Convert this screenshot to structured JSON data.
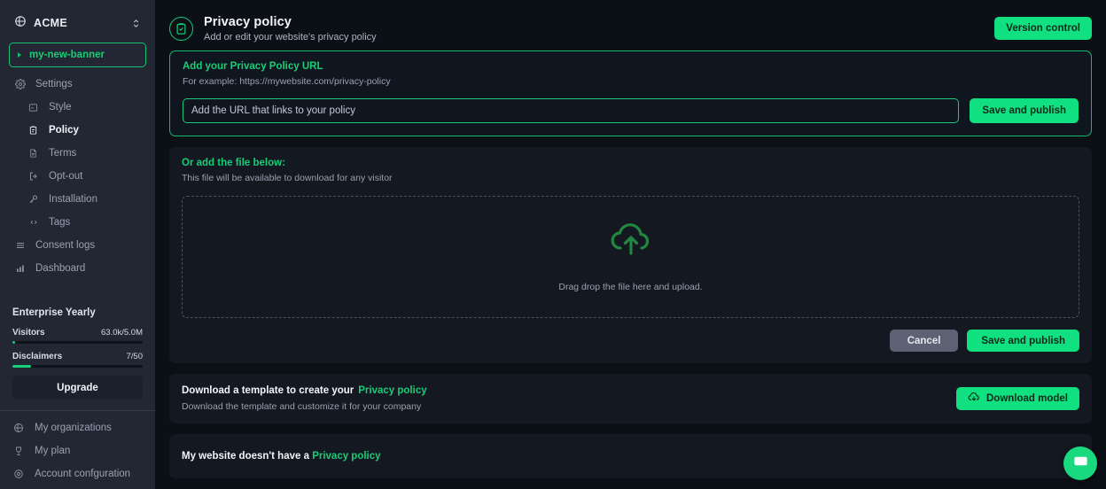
{
  "sidebar": {
    "org": {
      "name": "ACME",
      "icon": "globe-icon",
      "switcher_icon": "chevron-updown-icon"
    },
    "banner": {
      "label": "my-new-banner"
    },
    "nav": [
      {
        "label": "Settings",
        "icon": "gear-icon",
        "level": "top",
        "active": false
      },
      {
        "label": "Style",
        "icon": "window-icon",
        "level": "sub",
        "active": false
      },
      {
        "label": "Policy",
        "icon": "clipboard-icon",
        "level": "sub",
        "active": true
      },
      {
        "label": "Terms",
        "icon": "document-icon",
        "level": "sub",
        "active": false
      },
      {
        "label": "Opt-out",
        "icon": "logout-icon",
        "level": "sub",
        "active": false
      },
      {
        "label": "Installation",
        "icon": "key-icon",
        "level": "sub",
        "active": false
      },
      {
        "label": "Tags",
        "icon": "code-icon",
        "level": "sub",
        "active": false
      },
      {
        "label": "Consent logs",
        "icon": "list-icon",
        "level": "top",
        "active": false
      },
      {
        "label": "Dashboard",
        "icon": "bar-chart-icon",
        "level": "top",
        "active": false
      }
    ],
    "plan": {
      "title": "Enterprise Yearly",
      "meters": [
        {
          "name": "Visitors",
          "value": "63.0k/5.0M",
          "percent": 2
        },
        {
          "name": "Disclaimers",
          "value": "7/50",
          "percent": 14
        }
      ],
      "upgrade_label": "Upgrade"
    },
    "account": [
      {
        "label": "My organizations",
        "icon": "globe-icon"
      },
      {
        "label": "My plan",
        "icon": "trophy-icon"
      },
      {
        "label": "Account confguration",
        "icon": "gear-icon"
      }
    ]
  },
  "header": {
    "icon": "clipboard-check-icon",
    "title": "Privacy policy",
    "subtitle": "Add or edit your website's privacy policy",
    "version_control_label": "Version control"
  },
  "url_panel": {
    "title": "Add your Privacy Policy URL",
    "subtitle": "For example: https://mywebsite.com/privacy-policy",
    "input_placeholder": "Add the URL that links to your policy",
    "input_value": "",
    "save_label": "Save and publish"
  },
  "upload_panel": {
    "title": "Or add the file below:",
    "subtitle": "This file will be available to download for any visitor",
    "dropzone_icon": "cloud-upload-icon",
    "dropzone_text": "Drag drop the file here and upload.",
    "cancel_label": "Cancel",
    "save_label": "Save and publish"
  },
  "template_panel": {
    "title": "Download a template to create your",
    "title_link": "Privacy policy",
    "subtitle": "Download the template and customize it for your company",
    "button_icon": "cloud-download-icon",
    "button_label": "Download model"
  },
  "nohave_panel": {
    "text": "My website doesn't have a",
    "link": "Privacy policy"
  },
  "chat": {
    "icon": "chat-bubble-icon"
  },
  "colors": {
    "accent_green": "#10e07f",
    "link_green": "#17cd78",
    "page_bg": "#0b0f16",
    "panel_bg": "#131821",
    "sidebar_bg": "#222733",
    "gray_button": "#5c6274"
  }
}
